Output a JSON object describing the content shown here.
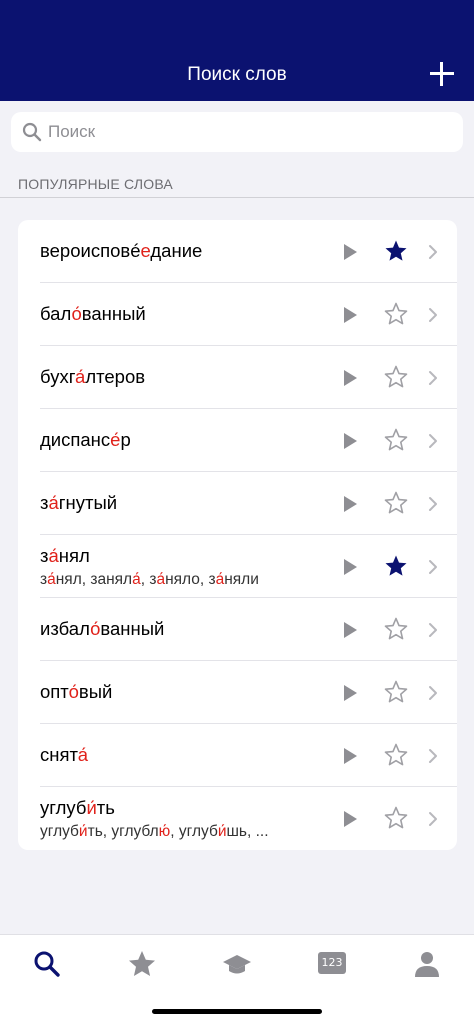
{
  "header": {
    "title": "Поиск слов",
    "add_icon": "plus-icon"
  },
  "search": {
    "placeholder": "Поиск",
    "value": ""
  },
  "section": {
    "title": "ПОПУЛЯРНЫЕ СЛОВА"
  },
  "colors": {
    "header_bg": "#0b1270",
    "accent": "#e0221b",
    "star_filled": "#0b1270"
  },
  "words": [
    {
      "pre": "вероисповé",
      "acc": "е",
      "post": "дание",
      "display": "вероисповéдание",
      "favorite": true,
      "forms": null
    },
    {
      "pre": "бал",
      "acc": "о́",
      "post": "ванный",
      "display": "бало́ванный",
      "favorite": false,
      "forms": null
    },
    {
      "pre": "бухг",
      "acc": "а́",
      "post": "лтеров",
      "display": "бухга́лтеров",
      "favorite": false,
      "forms": null
    },
    {
      "pre": "диспанс",
      "acc": "е́",
      "post": "р",
      "display": "диспансе́р",
      "favorite": false,
      "forms": null
    },
    {
      "pre": "з",
      "acc": "а́",
      "post": "гнутый",
      "display": "за́гнутый",
      "favorite": false,
      "forms": null
    },
    {
      "pre": "з",
      "acc": "а́",
      "post": "нял",
      "display": "за́нял",
      "favorite": true,
      "forms": [
        [
          "з",
          "а́",
          "нял, "
        ],
        [
          "занял",
          "а́",
          ", "
        ],
        [
          "з",
          "а́",
          "няло, "
        ],
        [
          "з",
          "а́",
          "няли"
        ]
      ]
    },
    {
      "pre": "избал",
      "acc": "о́",
      "post": "ванный",
      "display": "избало́ванный",
      "favorite": false,
      "forms": null
    },
    {
      "pre": "опт",
      "acc": "о́",
      "post": "вый",
      "display": "опто́вый",
      "favorite": false,
      "forms": null
    },
    {
      "pre": "снят",
      "acc": "а́",
      "post": "",
      "display": "снята́",
      "favorite": false,
      "forms": null
    },
    {
      "pre": "углуб",
      "acc": "и́",
      "post": "ть",
      "display": "углуби́ть",
      "favorite": false,
      "forms": [
        [
          "углуб",
          "и́",
          "ть, "
        ],
        [
          "углубл",
          "ю́",
          ", "
        ],
        [
          "углуб",
          "и́",
          "шь, ..."
        ]
      ]
    }
  ],
  "tabbar": {
    "tabs": [
      {
        "icon": "search-icon",
        "active": true
      },
      {
        "icon": "star-icon",
        "active": false
      },
      {
        "icon": "graduation-cap-icon",
        "active": false
      },
      {
        "icon": "numbers-icon",
        "label": "123",
        "active": false
      },
      {
        "icon": "profile-icon",
        "active": false
      }
    ]
  }
}
